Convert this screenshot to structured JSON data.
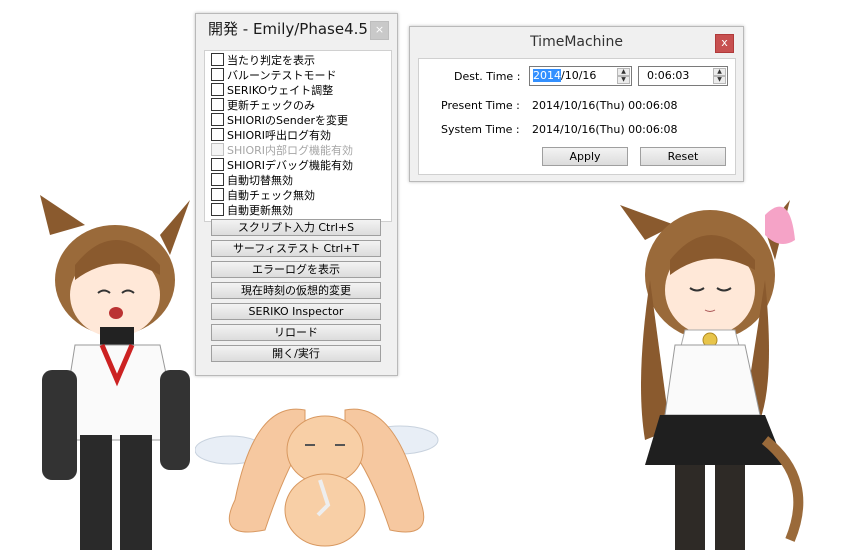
{
  "dev_panel": {
    "title": "開発 - Emily/Phase4.5",
    "close": "×",
    "checkboxes": [
      {
        "label": "当たり判定を表示",
        "enabled": true
      },
      {
        "label": "バルーンテストモード",
        "enabled": true
      },
      {
        "label": "SERIKOウェイト調整",
        "enabled": true
      },
      {
        "label": "更新チェックのみ",
        "enabled": true
      },
      {
        "label": "SHIORIのSenderを変更",
        "enabled": true
      },
      {
        "label": "SHIORI呼出ログ有効",
        "enabled": true
      },
      {
        "label": "SHIORI内部ログ機能有効",
        "enabled": false
      },
      {
        "label": "SHIORIデバッグ機能有効",
        "enabled": true
      },
      {
        "label": "自動切替無効",
        "enabled": true
      },
      {
        "label": "自動チェック無効",
        "enabled": true
      },
      {
        "label": "自動更新無効",
        "enabled": true
      }
    ],
    "buttons": [
      "スクリプト入力 Ctrl+S",
      "サーフィステスト Ctrl+T",
      "エラーログを表示",
      "現在時刻の仮想的変更",
      "SERIKO Inspector",
      "リロード",
      "開く/実行"
    ]
  },
  "time_machine": {
    "title": "TimeMachine",
    "close": "x",
    "dest_label": "Dest. Time :",
    "dest_date_selected": "2014",
    "dest_date_rest": "/10/16",
    "dest_time": "0:06:03",
    "present_label": "Present Time :",
    "present_value": "2014/10/16(Thu) 00:06:08",
    "system_label": "System Time :",
    "system_value": "2014/10/16(Thu) 00:06:08",
    "apply": "Apply",
    "reset": "Reset"
  },
  "colors": {
    "window_bg": "#f0f0f0",
    "close_red": "#c75050",
    "selection_blue": "#3390ff"
  }
}
